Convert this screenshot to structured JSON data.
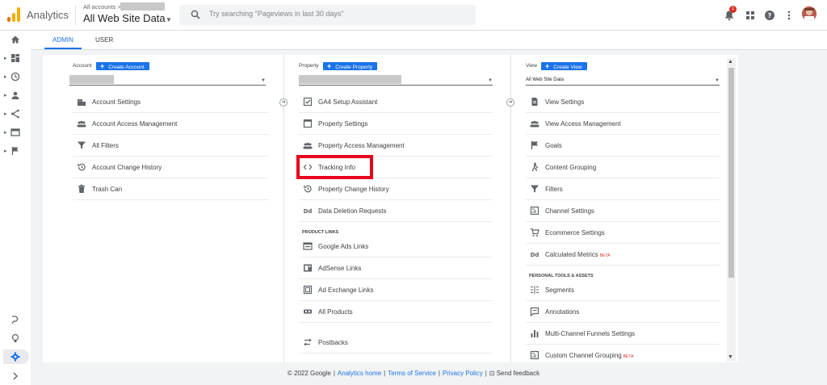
{
  "header": {
    "app_name": "Analytics",
    "account_breadcrumb": "All accounts >",
    "property_name": "All Web Site Data",
    "search_placeholder": "Try searching \"Pageviews in last 30 days\"",
    "notification_count": "1"
  },
  "tabs": {
    "admin": "ADMIN",
    "user": "USER"
  },
  "account_col": {
    "label": "Account",
    "create_button": "Create Account",
    "items": [
      "Account Settings",
      "Account Access Management",
      "All Filters",
      "Account Change History",
      "Trash Can"
    ]
  },
  "property_col": {
    "label": "Property",
    "create_button": "Create Property",
    "items": [
      "GA4 Setup Assistant",
      "Property Settings",
      "Property Access Management",
      "Tracking Info",
      "Property Change History",
      "Data Deletion Requests"
    ],
    "section_product_links": "PRODUCT LINKS",
    "product_links": [
      "Google Ads Links",
      "AdSense Links",
      "Ad Exchange Links",
      "All Products"
    ],
    "extra": [
      "Postbacks"
    ]
  },
  "view_col": {
    "label": "View",
    "create_button": "Create View",
    "selected_view": "All Web Site Data",
    "items": [
      "View Settings",
      "View Access Management",
      "Goals",
      "Content Grouping",
      "Filters",
      "Channel Settings",
      "Ecommerce Settings",
      "Calculated Metrics"
    ],
    "beta_label": "BETA",
    "section_personal": "PERSONAL TOOLS & ASSETS",
    "personal_items": [
      "Segments",
      "Annotations",
      "Multi-Channel Funnels Settings",
      "Custom Channel Grouping"
    ]
  },
  "footer": {
    "copyright": "© 2022 Google",
    "analytics_home": "Analytics home",
    "terms": "Terms of Service",
    "privacy": "Privacy Policy",
    "feedback": "Send feedback"
  },
  "colors": {
    "accent": "#1a73e8",
    "highlight": "#e8001c",
    "logo_orange": "#f9ab00",
    "logo_dark": "#e37400"
  }
}
